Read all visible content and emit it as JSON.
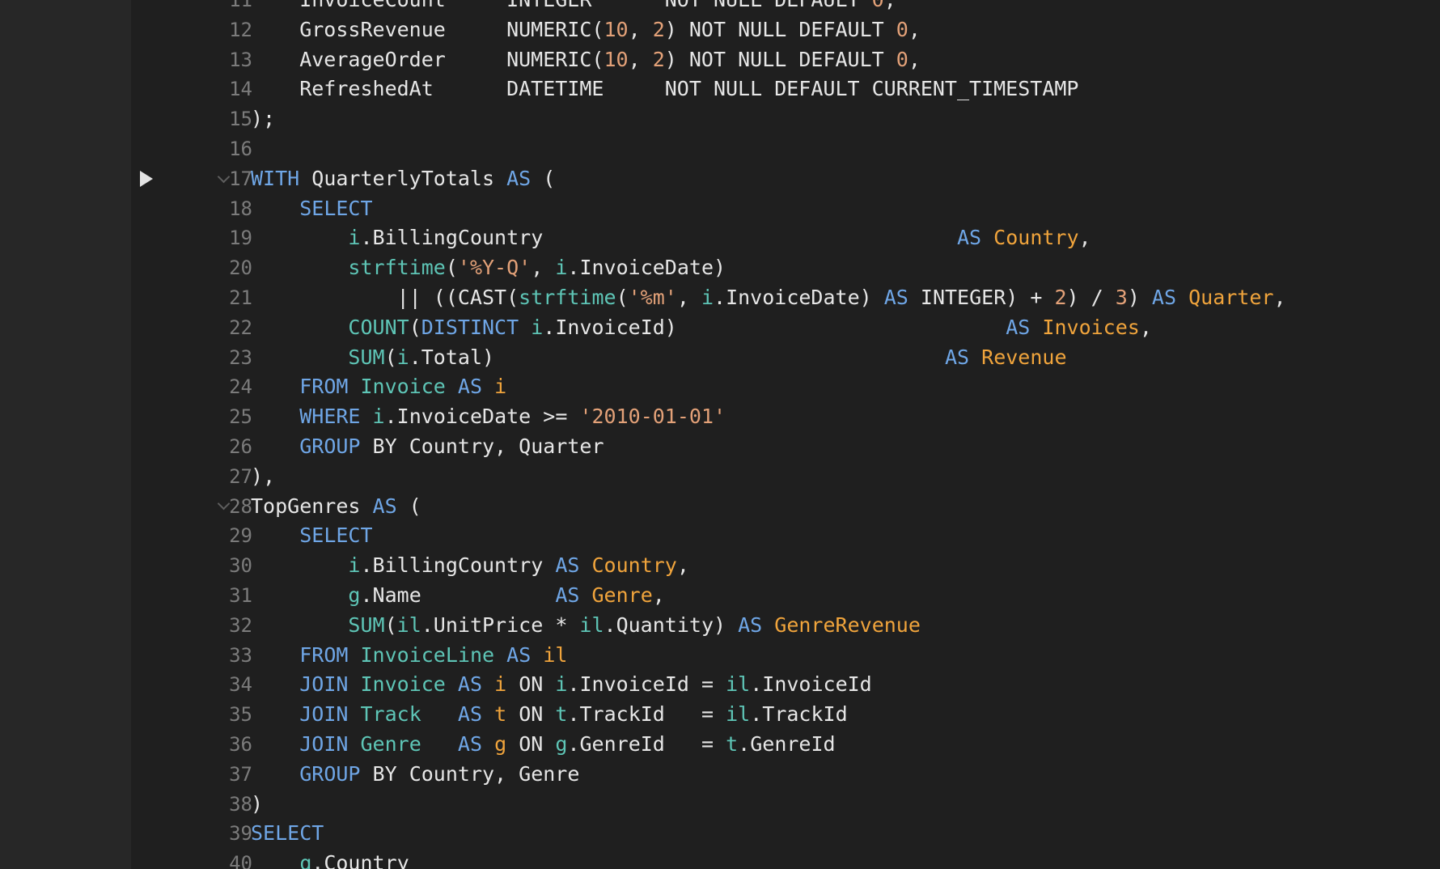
{
  "editor": {
    "colors": {
      "background": "#1f1f1f",
      "gutter_panel": "#272727",
      "line_number": "#7b7b7b",
      "keyword": "#6fa6e6",
      "table_alias": "#5ec5b6",
      "column_alias": "#f0a43c",
      "string_number": "#e3a178",
      "text": "#e6e6e6"
    },
    "run_marker_icon": "run-triangle-icon",
    "fold_icon": "chevron-down-icon",
    "lines": [
      {
        "num": "11",
        "marker": false,
        "fold": false,
        "tokens": [
          {
            "t": "    InvoiceCount     INTEGER      NOT NULL DEFAULT ",
            "c": "tx"
          },
          {
            "t": "0",
            "c": "num"
          },
          {
            "t": ",",
            "c": "tx"
          }
        ]
      },
      {
        "num": "12",
        "marker": false,
        "fold": false,
        "tokens": [
          {
            "t": "    GrossRevenue     NUMERIC(",
            "c": "tx"
          },
          {
            "t": "10",
            "c": "num"
          },
          {
            "t": ", ",
            "c": "tx"
          },
          {
            "t": "2",
            "c": "num"
          },
          {
            "t": ") NOT NULL DEFAULT ",
            "c": "tx"
          },
          {
            "t": "0",
            "c": "num"
          },
          {
            "t": ",",
            "c": "tx"
          }
        ]
      },
      {
        "num": "13",
        "marker": false,
        "fold": false,
        "tokens": [
          {
            "t": "    AverageOrder     NUMERIC(",
            "c": "tx"
          },
          {
            "t": "10",
            "c": "num"
          },
          {
            "t": ", ",
            "c": "tx"
          },
          {
            "t": "2",
            "c": "num"
          },
          {
            "t": ") NOT NULL DEFAULT ",
            "c": "tx"
          },
          {
            "t": "0",
            "c": "num"
          },
          {
            "t": ",",
            "c": "tx"
          }
        ]
      },
      {
        "num": "14",
        "marker": false,
        "fold": false,
        "tokens": [
          {
            "t": "    RefreshedAt      DATETIME     NOT NULL DEFAULT CURRENT_TIMESTAMP",
            "c": "tx"
          }
        ]
      },
      {
        "num": "15",
        "marker": false,
        "fold": false,
        "tokens": [
          {
            "t": ");",
            "c": "tx"
          }
        ]
      },
      {
        "num": "16",
        "marker": false,
        "fold": false,
        "tokens": []
      },
      {
        "num": "17",
        "marker": true,
        "fold": true,
        "tokens": [
          {
            "t": "WITH",
            "c": "kw"
          },
          {
            "t": " QuarterlyTotals ",
            "c": "tx"
          },
          {
            "t": "AS",
            "c": "kw"
          },
          {
            "t": " (",
            "c": "tx"
          }
        ]
      },
      {
        "num": "18",
        "marker": false,
        "fold": false,
        "tokens": [
          {
            "t": "    ",
            "c": "tx"
          },
          {
            "t": "SELECT",
            "c": "kw"
          }
        ]
      },
      {
        "num": "19",
        "marker": false,
        "fold": false,
        "tokens": [
          {
            "t": "        ",
            "c": "tx"
          },
          {
            "t": "i",
            "c": "id"
          },
          {
            "t": ".BillingCountry                                  ",
            "c": "tx"
          },
          {
            "t": "AS",
            "c": "kw"
          },
          {
            "t": " ",
            "c": "tx"
          },
          {
            "t": "Country",
            "c": "al"
          },
          {
            "t": ",",
            "c": "tx"
          }
        ]
      },
      {
        "num": "20",
        "marker": false,
        "fold": false,
        "tokens": [
          {
            "t": "        ",
            "c": "tx"
          },
          {
            "t": "strftime",
            "c": "id"
          },
          {
            "t": "(",
            "c": "tx"
          },
          {
            "t": "'%Y-Q'",
            "c": "str"
          },
          {
            "t": ", ",
            "c": "tx"
          },
          {
            "t": "i",
            "c": "id"
          },
          {
            "t": ".InvoiceDate)",
            "c": "tx"
          }
        ]
      },
      {
        "num": "21",
        "marker": false,
        "fold": false,
        "tokens": [
          {
            "t": "            || ((CAST(",
            "c": "tx"
          },
          {
            "t": "strftime",
            "c": "id"
          },
          {
            "t": "(",
            "c": "tx"
          },
          {
            "t": "'%m'",
            "c": "str"
          },
          {
            "t": ", ",
            "c": "tx"
          },
          {
            "t": "i",
            "c": "id"
          },
          {
            "t": ".InvoiceDate) ",
            "c": "tx"
          },
          {
            "t": "AS",
            "c": "kw"
          },
          {
            "t": " INTEGER) + ",
            "c": "tx"
          },
          {
            "t": "2",
            "c": "num"
          },
          {
            "t": ") / ",
            "c": "tx"
          },
          {
            "t": "3",
            "c": "num"
          },
          {
            "t": ") ",
            "c": "tx"
          },
          {
            "t": "AS",
            "c": "kw"
          },
          {
            "t": " ",
            "c": "tx"
          },
          {
            "t": "Quarter",
            "c": "al"
          },
          {
            "t": ",",
            "c": "tx"
          }
        ]
      },
      {
        "num": "22",
        "marker": false,
        "fold": false,
        "tokens": [
          {
            "t": "        ",
            "c": "tx"
          },
          {
            "t": "COUNT",
            "c": "id"
          },
          {
            "t": "(",
            "c": "tx"
          },
          {
            "t": "DISTINCT",
            "c": "kw"
          },
          {
            "t": " ",
            "c": "tx"
          },
          {
            "t": "i",
            "c": "id"
          },
          {
            "t": ".InvoiceId)                           ",
            "c": "tx"
          },
          {
            "t": "AS",
            "c": "kw"
          },
          {
            "t": " ",
            "c": "tx"
          },
          {
            "t": "Invoices",
            "c": "al"
          },
          {
            "t": ",",
            "c": "tx"
          }
        ]
      },
      {
        "num": "23",
        "marker": false,
        "fold": false,
        "tokens": [
          {
            "t": "        ",
            "c": "tx"
          },
          {
            "t": "SUM",
            "c": "id"
          },
          {
            "t": "(",
            "c": "tx"
          },
          {
            "t": "i",
            "c": "id"
          },
          {
            "t": ".Total)                                     ",
            "c": "tx"
          },
          {
            "t": "AS",
            "c": "kw"
          },
          {
            "t": " ",
            "c": "tx"
          },
          {
            "t": "Revenue",
            "c": "al"
          }
        ]
      },
      {
        "num": "24",
        "marker": false,
        "fold": false,
        "tokens": [
          {
            "t": "    ",
            "c": "tx"
          },
          {
            "t": "FROM",
            "c": "kw"
          },
          {
            "t": " ",
            "c": "tx"
          },
          {
            "t": "Invoice",
            "c": "id"
          },
          {
            "t": " ",
            "c": "tx"
          },
          {
            "t": "AS",
            "c": "kw"
          },
          {
            "t": " ",
            "c": "tx"
          },
          {
            "t": "i",
            "c": "al"
          }
        ]
      },
      {
        "num": "25",
        "marker": false,
        "fold": false,
        "tokens": [
          {
            "t": "    ",
            "c": "tx"
          },
          {
            "t": "WHERE",
            "c": "kw"
          },
          {
            "t": " ",
            "c": "tx"
          },
          {
            "t": "i",
            "c": "id"
          },
          {
            "t": ".InvoiceDate >= ",
            "c": "tx"
          },
          {
            "t": "'2010-01-01'",
            "c": "str"
          }
        ]
      },
      {
        "num": "26",
        "marker": false,
        "fold": false,
        "tokens": [
          {
            "t": "    ",
            "c": "tx"
          },
          {
            "t": "GROUP",
            "c": "kw"
          },
          {
            "t": " BY Country, Quarter",
            "c": "tx"
          }
        ]
      },
      {
        "num": "27",
        "marker": false,
        "fold": false,
        "tokens": [
          {
            "t": "),",
            "c": "tx"
          }
        ]
      },
      {
        "num": "28",
        "marker": false,
        "fold": true,
        "tokens": [
          {
            "t": "TopGenres ",
            "c": "tx"
          },
          {
            "t": "AS",
            "c": "kw"
          },
          {
            "t": " (",
            "c": "tx"
          }
        ]
      },
      {
        "num": "29",
        "marker": false,
        "fold": false,
        "tokens": [
          {
            "t": "    ",
            "c": "tx"
          },
          {
            "t": "SELECT",
            "c": "kw"
          }
        ]
      },
      {
        "num": "30",
        "marker": false,
        "fold": false,
        "tokens": [
          {
            "t": "        ",
            "c": "tx"
          },
          {
            "t": "i",
            "c": "id"
          },
          {
            "t": ".BillingCountry ",
            "c": "tx"
          },
          {
            "t": "AS",
            "c": "kw"
          },
          {
            "t": " ",
            "c": "tx"
          },
          {
            "t": "Country",
            "c": "al"
          },
          {
            "t": ",",
            "c": "tx"
          }
        ]
      },
      {
        "num": "31",
        "marker": false,
        "fold": false,
        "tokens": [
          {
            "t": "        ",
            "c": "tx"
          },
          {
            "t": "g",
            "c": "id"
          },
          {
            "t": ".Name           ",
            "c": "tx"
          },
          {
            "t": "AS",
            "c": "kw"
          },
          {
            "t": " ",
            "c": "tx"
          },
          {
            "t": "Genre",
            "c": "al"
          },
          {
            "t": ",",
            "c": "tx"
          }
        ]
      },
      {
        "num": "32",
        "marker": false,
        "fold": false,
        "tokens": [
          {
            "t": "        ",
            "c": "tx"
          },
          {
            "t": "SUM",
            "c": "id"
          },
          {
            "t": "(",
            "c": "tx"
          },
          {
            "t": "il",
            "c": "id"
          },
          {
            "t": ".UnitPrice * ",
            "c": "tx"
          },
          {
            "t": "il",
            "c": "id"
          },
          {
            "t": ".Quantity) ",
            "c": "tx"
          },
          {
            "t": "AS",
            "c": "kw"
          },
          {
            "t": " ",
            "c": "tx"
          },
          {
            "t": "GenreRevenue",
            "c": "al"
          }
        ]
      },
      {
        "num": "33",
        "marker": false,
        "fold": false,
        "tokens": [
          {
            "t": "    ",
            "c": "tx"
          },
          {
            "t": "FROM",
            "c": "kw"
          },
          {
            "t": " ",
            "c": "tx"
          },
          {
            "t": "InvoiceLine",
            "c": "id"
          },
          {
            "t": " ",
            "c": "tx"
          },
          {
            "t": "AS",
            "c": "kw"
          },
          {
            "t": " ",
            "c": "tx"
          },
          {
            "t": "il",
            "c": "al"
          }
        ]
      },
      {
        "num": "34",
        "marker": false,
        "fold": false,
        "tokens": [
          {
            "t": "    ",
            "c": "tx"
          },
          {
            "t": "JOIN",
            "c": "kw"
          },
          {
            "t": " ",
            "c": "tx"
          },
          {
            "t": "Invoice",
            "c": "id"
          },
          {
            "t": " ",
            "c": "tx"
          },
          {
            "t": "AS",
            "c": "kw"
          },
          {
            "t": " ",
            "c": "tx"
          },
          {
            "t": "i",
            "c": "al"
          },
          {
            "t": " ON ",
            "c": "tx"
          },
          {
            "t": "i",
            "c": "id"
          },
          {
            "t": ".InvoiceId = ",
            "c": "tx"
          },
          {
            "t": "il",
            "c": "id"
          },
          {
            "t": ".InvoiceId",
            "c": "tx"
          }
        ]
      },
      {
        "num": "35",
        "marker": false,
        "fold": false,
        "tokens": [
          {
            "t": "    ",
            "c": "tx"
          },
          {
            "t": "JOIN",
            "c": "kw"
          },
          {
            "t": " ",
            "c": "tx"
          },
          {
            "t": "Track",
            "c": "id"
          },
          {
            "t": "   ",
            "c": "tx"
          },
          {
            "t": "AS",
            "c": "kw"
          },
          {
            "t": " ",
            "c": "tx"
          },
          {
            "t": "t",
            "c": "al"
          },
          {
            "t": " ON ",
            "c": "tx"
          },
          {
            "t": "t",
            "c": "id"
          },
          {
            "t": ".TrackId   = ",
            "c": "tx"
          },
          {
            "t": "il",
            "c": "id"
          },
          {
            "t": ".TrackId",
            "c": "tx"
          }
        ]
      },
      {
        "num": "36",
        "marker": false,
        "fold": false,
        "tokens": [
          {
            "t": "    ",
            "c": "tx"
          },
          {
            "t": "JOIN",
            "c": "kw"
          },
          {
            "t": " ",
            "c": "tx"
          },
          {
            "t": "Genre",
            "c": "id"
          },
          {
            "t": "   ",
            "c": "tx"
          },
          {
            "t": "AS",
            "c": "kw"
          },
          {
            "t": " ",
            "c": "tx"
          },
          {
            "t": "g",
            "c": "al"
          },
          {
            "t": " ON ",
            "c": "tx"
          },
          {
            "t": "g",
            "c": "id"
          },
          {
            "t": ".GenreId   = ",
            "c": "tx"
          },
          {
            "t": "t",
            "c": "id"
          },
          {
            "t": ".GenreId",
            "c": "tx"
          }
        ]
      },
      {
        "num": "37",
        "marker": false,
        "fold": false,
        "tokens": [
          {
            "t": "    ",
            "c": "tx"
          },
          {
            "t": "GROUP",
            "c": "kw"
          },
          {
            "t": " BY Country, Genre",
            "c": "tx"
          }
        ]
      },
      {
        "num": "38",
        "marker": false,
        "fold": false,
        "tokens": [
          {
            "t": ")",
            "c": "tx"
          }
        ]
      },
      {
        "num": "39",
        "marker": false,
        "fold": false,
        "tokens": [
          {
            "t": "SELECT",
            "c": "kw"
          }
        ]
      },
      {
        "num": "40",
        "marker": false,
        "fold": false,
        "tokens": [
          {
            "t": "    ",
            "c": "tx"
          },
          {
            "t": "q",
            "c": "id"
          },
          {
            "t": ".Country",
            "c": "tx"
          }
        ]
      }
    ]
  }
}
